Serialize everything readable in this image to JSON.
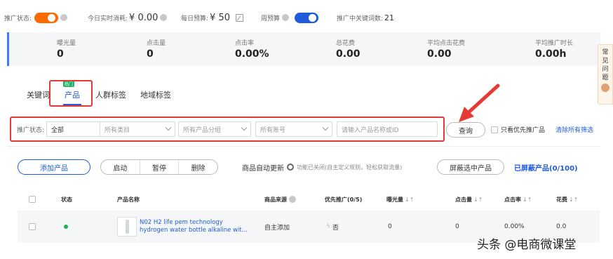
{
  "topbar": {
    "promo_status_label": "推广状态:",
    "realtime_spend_label": "今日实时消耗:",
    "realtime_spend_value": "¥ 0.00",
    "daily_budget_label": "每日预算:",
    "daily_budget_value": "¥ 50",
    "weekly_budget_label": "周预算",
    "keywords_label": "推广中关键词数:",
    "keywords_value": "21"
  },
  "stats": [
    {
      "label": "曝光量",
      "value": "0"
    },
    {
      "label": "点击量",
      "value": "0"
    },
    {
      "label": "点击率",
      "value": "0.00%"
    },
    {
      "label": "总花费",
      "value": "0.00"
    },
    {
      "label": "平均点击花费",
      "value": "0.00"
    },
    {
      "label": "平均推广时长",
      "value": "0.00h"
    }
  ],
  "side_help": {
    "chars": [
      "常",
      "见",
      "问",
      "题"
    ]
  },
  "tabs": [
    {
      "label": "关键词"
    },
    {
      "label": "产品",
      "badge": "热门"
    },
    {
      "label": "人群标签"
    },
    {
      "label": "地域标签"
    }
  ],
  "filters": {
    "status_label": "推广状态:",
    "status_value": "全部",
    "category": "所有类目",
    "group": "所有产品分组",
    "account": "所有账号",
    "search_placeholder": "请输入产品名称或ID"
  },
  "query_button": "查询",
  "only_priority": "只看优先推广品",
  "clear_filters": "清除所有筛选",
  "actions": {
    "add_product": "添加产品",
    "start": "启动",
    "pause": "暂停",
    "delete": "删除",
    "auto_update": "商品自动更新",
    "auto_update_desc": "功能已关闭(自主定义规则，轻松获取流量)",
    "block_selected": "屏蔽选中产品",
    "blocked_products": "已屏蔽产品(0/100)"
  },
  "table": {
    "headers": {
      "status": "状态",
      "name": "产品名称",
      "source": "商品来源",
      "priority": "优先推广(0/5)",
      "impressions": "曝光量",
      "clicks": "点击量",
      "ctr": "点击率",
      "cost": "花费"
    },
    "rows": [
      {
        "name_line1": "N02 H2 life pem technology",
        "name_line2": "hydrogen water bottle alkaline wit...",
        "source": "自主添加",
        "priority": "否",
        "impressions": "0",
        "clicks": "0",
        "ctr": "0.00%",
        "cost": "0.0"
      }
    ]
  },
  "watermark": "头条 @电商微课堂",
  "colors": {
    "accent": "#1f5bdb",
    "orange": "#ff6a00",
    "highlight_red": "#e53935",
    "status_green": "#1fb155"
  }
}
